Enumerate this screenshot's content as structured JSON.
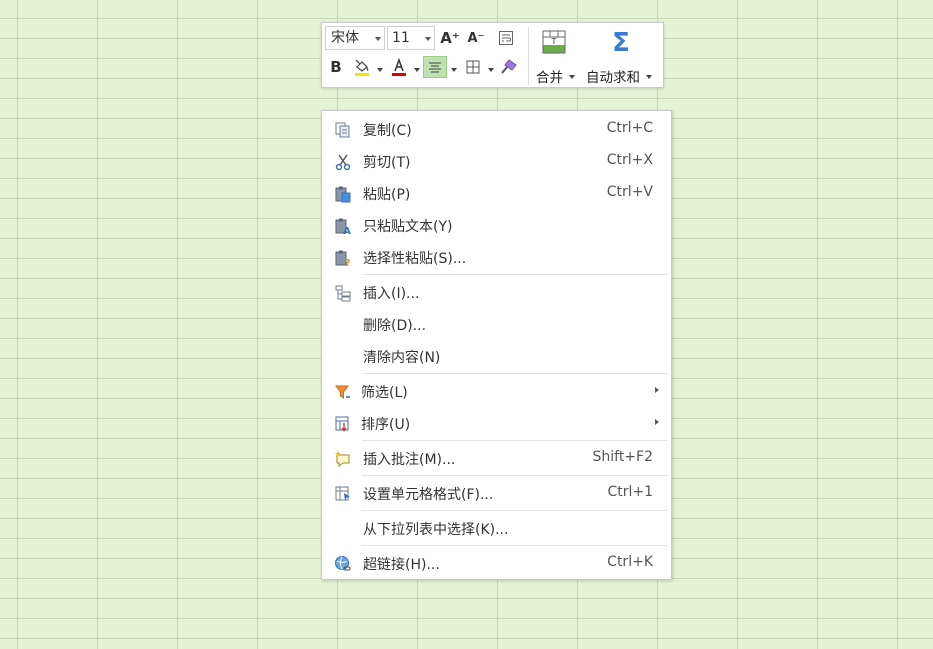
{
  "toolbar": {
    "font_name": "宋体",
    "font_size": "11",
    "increase_font_label": "A⁺",
    "decrease_font_label": "A⁻",
    "bold_label": "B",
    "font_color_label": "A",
    "merge_label": "合并",
    "autosum_label": "自动求和",
    "autosum_symbol": "Σ",
    "colors": {
      "fill_highlight": "#f5e400",
      "font_color": "#e00000",
      "merge_green": "#6aad4a",
      "sigma_blue": "#3a7bd5"
    }
  },
  "context_menu": {
    "items": [
      {
        "label": "复制(C)",
        "shortcut": "Ctrl+C",
        "icon": "copy-icon"
      },
      {
        "label": "剪切(T)",
        "shortcut": "Ctrl+X",
        "icon": "scissors-icon"
      },
      {
        "label": "粘贴(P)",
        "shortcut": "Ctrl+V",
        "icon": "paste-icon"
      },
      {
        "label": "只粘贴文本(Y)",
        "shortcut": "",
        "icon": "paste-text-icon"
      },
      {
        "label": "选择性粘贴(S)...",
        "shortcut": "",
        "icon": "paste-special-icon"
      },
      {
        "label": "插入(I)...",
        "shortcut": "",
        "icon": "insert-cells-icon"
      },
      {
        "label": "删除(D)...",
        "shortcut": "",
        "icon": ""
      },
      {
        "label": "清除内容(N)",
        "shortcut": "",
        "icon": ""
      },
      {
        "label": "筛选(L)",
        "shortcut": "",
        "icon": "filter-icon",
        "submenu": true
      },
      {
        "label": "排序(U)",
        "shortcut": "",
        "icon": "sort-icon",
        "submenu": true
      },
      {
        "label": "插入批注(M)...",
        "shortcut": "Shift+F2",
        "icon": "comment-icon"
      },
      {
        "label": "设置单元格格式(F)...",
        "shortcut": "Ctrl+1",
        "icon": "format-cells-icon"
      },
      {
        "label": "从下拉列表中选择(K)...",
        "shortcut": "",
        "icon": ""
      },
      {
        "label": "超链接(H)...",
        "shortcut": "Ctrl+K",
        "icon": "hyperlink-icon"
      }
    ]
  }
}
